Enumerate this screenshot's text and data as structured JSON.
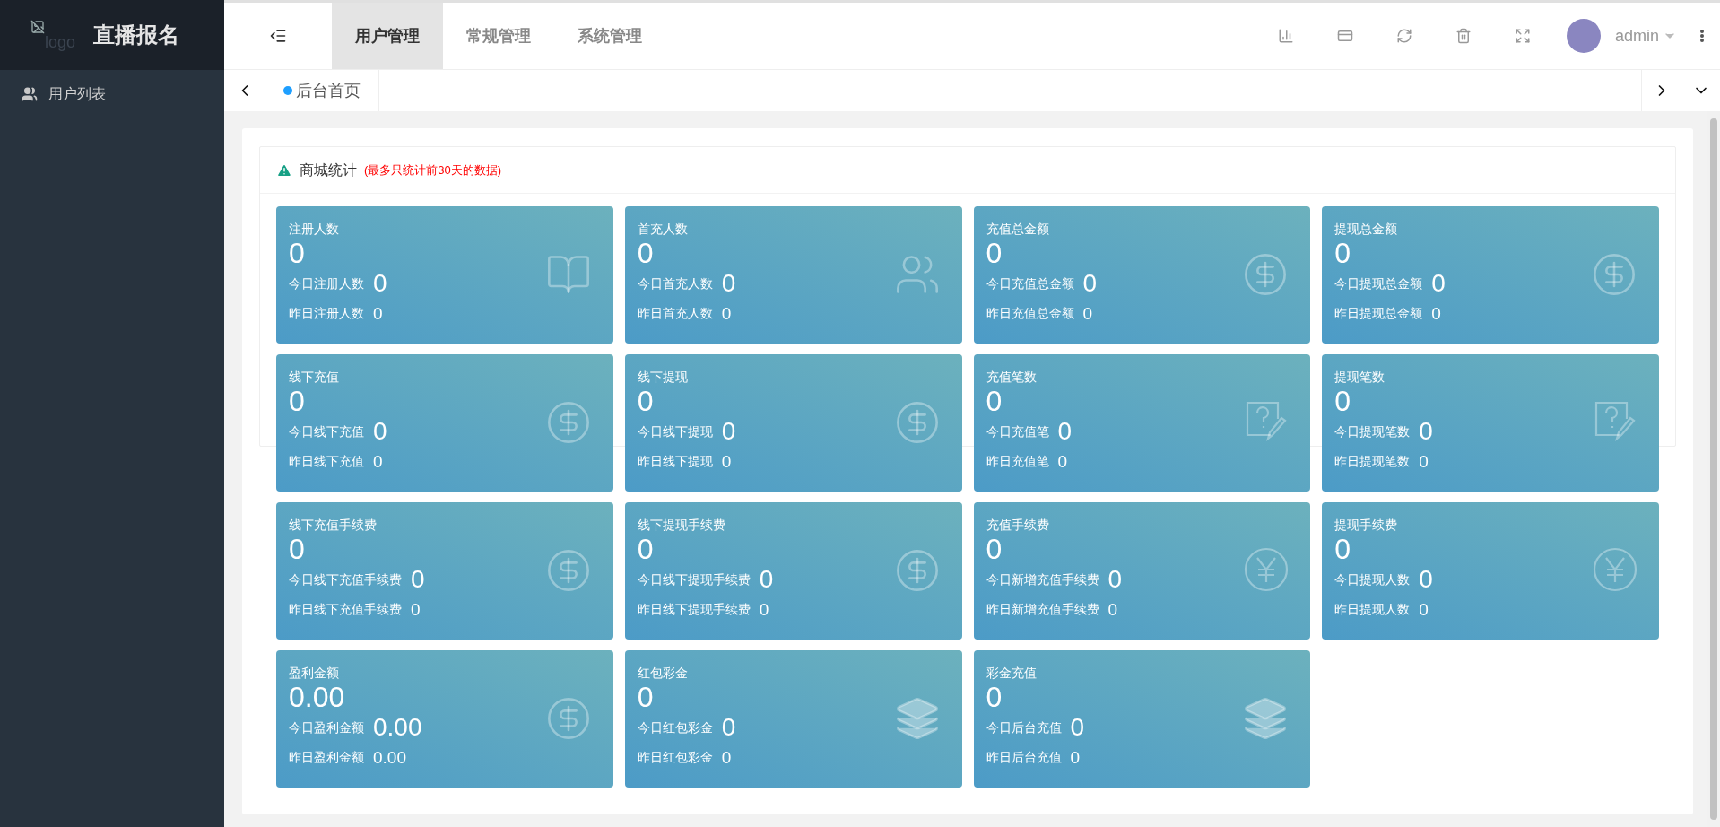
{
  "sidebar": {
    "logo_alt": "logo",
    "brand": "直播报名",
    "items": [
      {
        "label": "用户列表"
      }
    ]
  },
  "topbar": {
    "nav": [
      {
        "label": "用户管理",
        "selected": true
      },
      {
        "label": "常规管理",
        "selected": false
      },
      {
        "label": "系统管理",
        "selected": false
      }
    ],
    "user": {
      "name": "admin"
    }
  },
  "tabs_bar": {
    "tabs": [
      {
        "label": "后台首页",
        "selected": true
      }
    ]
  },
  "panel": {
    "title": "商城统计",
    "note": "(最多只统计前30天的数据)",
    "cards": [
      {
        "kind": "book",
        "title": "注册人数",
        "value": "0",
        "today_label": "今日注册人数",
        "today_value": "0",
        "yesterday_label": "昨日注册人数",
        "yesterday_value": "0"
      },
      {
        "kind": "users",
        "title": "首充人数",
        "value": "0",
        "today_label": "今日首充人数",
        "today_value": "0",
        "yesterday_label": "昨日首充人数",
        "yesterday_value": "0"
      },
      {
        "kind": "dollar",
        "title": "充值总金额",
        "value": "0",
        "today_label": "今日充值总金额",
        "today_value": "0",
        "yesterday_label": "昨日充值总金额",
        "yesterday_value": "0"
      },
      {
        "kind": "dollar",
        "title": "提现总金额",
        "value": "0",
        "today_label": "今日提现总金额",
        "today_value": "0",
        "yesterday_label": "昨日提现总金额",
        "yesterday_value": "0"
      },
      {
        "kind": "dollar",
        "title": "线下充值",
        "value": "0",
        "today_label": "今日线下充值",
        "today_value": "0",
        "yesterday_label": "昨日线下充值",
        "yesterday_value": "0"
      },
      {
        "kind": "dollar",
        "title": "线下提现",
        "value": "0",
        "today_label": "今日线下提现",
        "today_value": "0",
        "yesterday_label": "昨日线下提现",
        "yesterday_value": "0"
      },
      {
        "kind": "question",
        "title": "充值笔数",
        "value": "0",
        "today_label": "今日充值笔",
        "today_value": "0",
        "yesterday_label": "昨日充值笔",
        "yesterday_value": "0"
      },
      {
        "kind": "question",
        "title": "提现笔数",
        "value": "0",
        "today_label": "今日提现笔数",
        "today_value": "0",
        "yesterday_label": "昨日提现笔数",
        "yesterday_value": "0"
      },
      {
        "kind": "dollar",
        "title": "线下充值手续费",
        "value": "0",
        "today_label": "今日线下充值手续费",
        "today_value": "0",
        "yesterday_label": "昨日线下充值手续费",
        "yesterday_value": "0"
      },
      {
        "kind": "dollar",
        "title": "线下提现手续费",
        "value": "0",
        "today_label": "今日线下提现手续费",
        "today_value": "0",
        "yesterday_label": "昨日线下提现手续费",
        "yesterday_value": "0"
      },
      {
        "kind": "yen",
        "title": "充值手续费",
        "value": "0",
        "today_label": "今日新增充值手续费",
        "today_value": "0",
        "yesterday_label": "昨日新增充值手续费",
        "yesterday_value": "0"
      },
      {
        "kind": "yen",
        "title": "提现手续费",
        "value": "0",
        "today_label": "今日提现人数",
        "today_value": "0",
        "yesterday_label": "昨日提现人数",
        "yesterday_value": "0"
      },
      {
        "kind": "dollar",
        "title": "盈利金额",
        "value": "0.00",
        "today_label": "今日盈利金额",
        "today_value": "0.00",
        "yesterday_label": "昨日盈利金额",
        "yesterday_value": "0.00"
      },
      {
        "kind": "layers",
        "title": "红包彩金",
        "value": "0",
        "today_label": "今日红包彩金",
        "today_value": "0",
        "yesterday_label": "昨日红包彩金",
        "yesterday_value": "0"
      },
      {
        "kind": "layers",
        "title": "彩金充值",
        "value": "0",
        "today_label": "今日后台充值",
        "today_value": "0",
        "yesterday_label": "昨日后台充值",
        "yesterday_value": "0"
      }
    ]
  }
}
